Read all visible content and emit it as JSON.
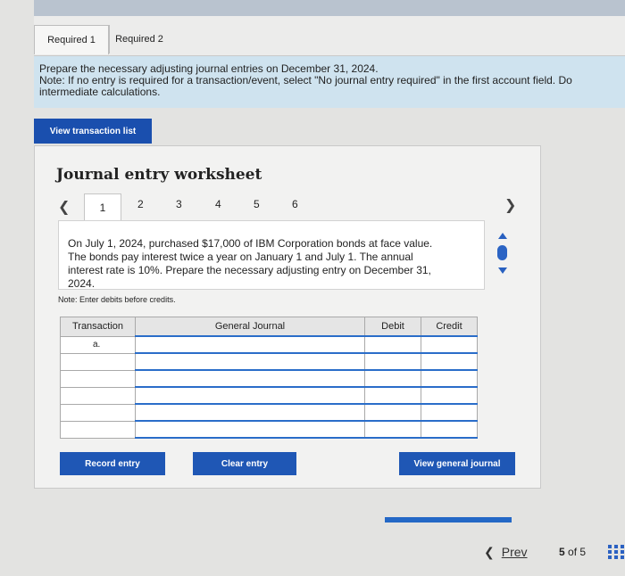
{
  "tabs": [
    {
      "label": "Required 1",
      "active": true
    },
    {
      "label": "Required 2",
      "active": false
    }
  ],
  "instructions": {
    "line1": "Prepare the necessary adjusting journal entries on December 31, 2024.",
    "line2": "Note: If no entry is required for a transaction/event, select \"No journal entry required\" in the first account field. Do",
    "line3": "intermediate calculations."
  },
  "view_transaction_list": "View transaction list",
  "worksheet": {
    "title": "Journal entry worksheet",
    "steps": [
      "1",
      "2",
      "3",
      "4",
      "5",
      "6"
    ],
    "active_step": "1",
    "prompt_lines": [
      "On July 1, 2024, purchased $17,000 of IBM Corporation bonds at face value.",
      "The bonds pay interest twice a year on January 1 and July 1. The annual",
      "interest rate is 10%. Prepare the necessary adjusting entry on December 31,",
      "2024."
    ],
    "note": "Note: Enter debits before credits.",
    "table": {
      "headers": [
        "Transaction",
        "General Journal",
        "Debit",
        "Credit"
      ],
      "rows": [
        {
          "transaction": "a.",
          "account": "",
          "debit": "",
          "credit": ""
        },
        {
          "transaction": "",
          "account": "",
          "debit": "",
          "credit": ""
        },
        {
          "transaction": "",
          "account": "",
          "debit": "",
          "credit": ""
        },
        {
          "transaction": "",
          "account": "",
          "debit": "",
          "credit": ""
        },
        {
          "transaction": "",
          "account": "",
          "debit": "",
          "credit": ""
        },
        {
          "transaction": "",
          "account": "",
          "debit": "",
          "credit": ""
        }
      ]
    }
  },
  "buttons": {
    "record": "Record entry",
    "clear": "Clear entry",
    "view_general": "View general journal"
  },
  "pager": {
    "prev_label": "Prev",
    "current": "5",
    "of": "of",
    "total": "5"
  },
  "icons": {
    "prev": "chevron-left-icon",
    "grid": "grid-icon"
  },
  "colors": {
    "accent": "#1f57b5",
    "instructions_bg": "#cfe3ef",
    "header_bar": "#b9c3cf"
  }
}
